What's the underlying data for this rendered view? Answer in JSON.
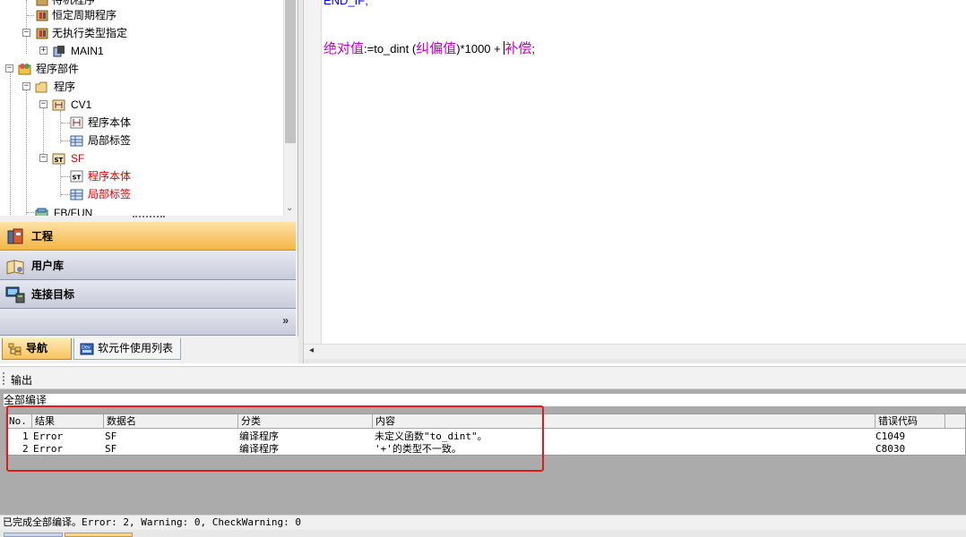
{
  "tree": {
    "items": [
      {
        "label": "待机程序",
        "red": false
      },
      {
        "label": "恒定周期程序",
        "red": false
      },
      {
        "label": "无执行类型指定",
        "red": false
      },
      {
        "label": "MAIN1",
        "red": false
      },
      {
        "label": "程序部件",
        "red": false
      },
      {
        "label": "程序",
        "red": false
      },
      {
        "label": "CV1",
        "red": false
      },
      {
        "label": "程序本体",
        "red": false
      },
      {
        "label": "局部标签",
        "red": false
      },
      {
        "label": "SF",
        "red": true
      },
      {
        "label": "程序本体",
        "red": true
      },
      {
        "label": "局部标签",
        "red": true
      },
      {
        "label": "FB/FUN",
        "red": false
      }
    ]
  },
  "nav": {
    "project": "工程",
    "user_lib": "用户库",
    "connect_target": "连接目标",
    "more": "»"
  },
  "tabs": {
    "navigation": "导航",
    "device_list": "软元件使用列表"
  },
  "editor": {
    "line1": "END_IF;",
    "var_abs": "绝对值",
    "assign": ":=to_dint (",
    "var_corr": "纠偏值",
    "mult": ")*1000 + ",
    "var_comp": "补偿",
    "end": ";"
  },
  "output": {
    "title": "输出",
    "compile_label": "全部编译",
    "columns": [
      "No.",
      "结果",
      "数据名",
      "分类",
      "内容",
      "错误代码"
    ],
    "rows": [
      {
        "no": "1",
        "result": "Error",
        "data_name": "SF",
        "category": "编译程序",
        "content": "未定义函数\"to_dint\"。",
        "code": "C1049"
      },
      {
        "no": "2",
        "result": "Error",
        "data_name": "SF",
        "category": "编译程序",
        "content": "'+'的类型不一致。",
        "code": "C8030"
      }
    ],
    "status": "已完成全部编译。Error: 2, Warning: 0, CheckWarning: 0"
  },
  "colors": {
    "highlight": "#e01b1b",
    "nav_active": "#f6b445",
    "error_red": "#d80000",
    "variable_magenta": "#c400c4",
    "keyword_blue": "#0000ff"
  }
}
